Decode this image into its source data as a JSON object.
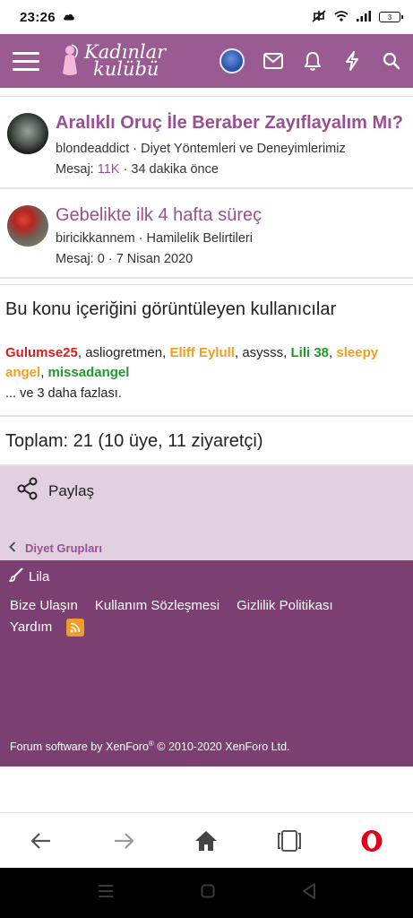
{
  "status": {
    "time": "23:26",
    "battery": "3"
  },
  "header": {
    "logo_line1": "Kadınlar",
    "logo_line2": "kulübü"
  },
  "threads": [
    {
      "title": "Aralıklı Oruç İle Beraber Zayıflayalım Mı?",
      "author": "blondeaddict",
      "forum": "Diyet Yöntemleri ve Deneyimlerimiz",
      "replies_label": "Mesaj:",
      "replies": "11K",
      "time": "34 dakika önce"
    },
    {
      "title": "Gebelikte ilk 4 hafta süreç",
      "author": "biricikkannem",
      "forum": "Hamilelik Belirtileri",
      "replies_label": "Mesaj:",
      "replies": "0",
      "time": "7 Nisan 2020"
    }
  ],
  "viewers": {
    "title": "Bu konu içeriğini görüntüleyen kullanıcılar",
    "users": [
      "Gulumse25",
      "asliogretmen",
      "Eliff Eylull",
      "asysss",
      "Lili 38",
      "sleepy angel",
      "missadangel"
    ],
    "more": "... ve 3 daha fazlası."
  },
  "totals": "Toplam: 21 (10 üye, 11 ziyaretçi)",
  "share": {
    "label": "Paylaş"
  },
  "breadcrumb": {
    "label": "Diyet Grupları"
  },
  "footer": {
    "style_label": "Lila",
    "links": [
      "Bize Ulaşın",
      "Kullanım Sözleşmesi",
      "Gizlilik Politikası",
      "Yardım"
    ],
    "copyright_pre": "Forum software by XenForo",
    "copyright_reg": "®",
    "copyright_post": " © 2010-2020 XenForo Ltd."
  },
  "colors": {
    "brand": "#9a5b93",
    "footer": "#7b3f71",
    "share_bg": "#e2d0e0",
    "link": "#9a4f93"
  }
}
